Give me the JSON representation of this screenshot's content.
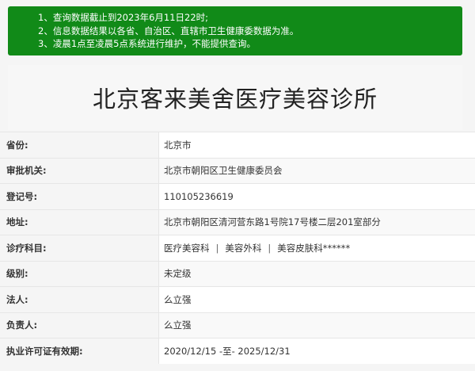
{
  "notice": {
    "lines": [
      "1、查询数据截止到2023年6月11日22时;",
      "2、信息数据结果以各省、自治区、直辖市卫生健康委数据为准。",
      "3、凌晨1点至凌晨5点系统进行维护，不能提供查询。"
    ]
  },
  "page_title": "北京客来美舍医疗美容诊所",
  "colors": {
    "notice_bg": "#118a18",
    "notice_text": "#ffffff"
  },
  "rows": [
    {
      "label": "省份:",
      "value": "北京市"
    },
    {
      "label": "审批机关:",
      "value": "北京市朝阳区卫生健康委员会"
    },
    {
      "label": "登记号:",
      "value": "110105236619"
    },
    {
      "label": "地址:",
      "value": "北京市朝阳区清河营东路1号院17号楼二层201室部分"
    },
    {
      "label": "诊疗科目:",
      "departments": [
        "医疗美容科",
        "美容外科",
        "美容皮肤科******"
      ],
      "separator": "|"
    },
    {
      "label": "级别:",
      "value": "未定级"
    },
    {
      "label": "法人:",
      "value": "么立强"
    },
    {
      "label": "负责人:",
      "value": "么立强"
    },
    {
      "label": "执业许可证有效期:",
      "value": "2020/12/15 -至- 2025/12/31"
    }
  ]
}
